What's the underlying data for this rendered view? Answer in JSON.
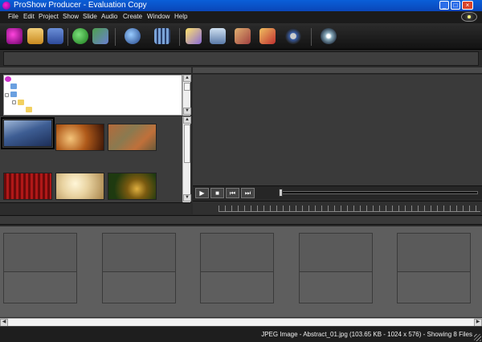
{
  "window": {
    "title": "ProShow Producer - Evaluation Copy"
  },
  "menu": [
    "File",
    "Edit",
    "Project",
    "Show",
    "Slide",
    "Audio",
    "Create",
    "Window",
    "Help"
  ],
  "toolbar_icons": [
    "proshow-icon",
    "open-icon",
    "save-icon",
    "play-icon",
    "preview-icon",
    "publish-icon",
    "movie-icon",
    "effects-icon",
    "slide-options-icon",
    "image-options-icon",
    "captions-icon",
    "sound-icon",
    "disc-icon"
  ],
  "transport": {
    "play": "▶",
    "stop": "■",
    "prev": "⏮",
    "next": "⏭"
  },
  "status": {
    "text": "JPEG Image - Abstract_01.jpg (103.65 KB - 1024 x 576) - Showing 8 Files"
  },
  "colors": {
    "titlebar": "#0a5fd8",
    "panel": "#3c3c3c",
    "slide_area": "#5e5e5e"
  }
}
